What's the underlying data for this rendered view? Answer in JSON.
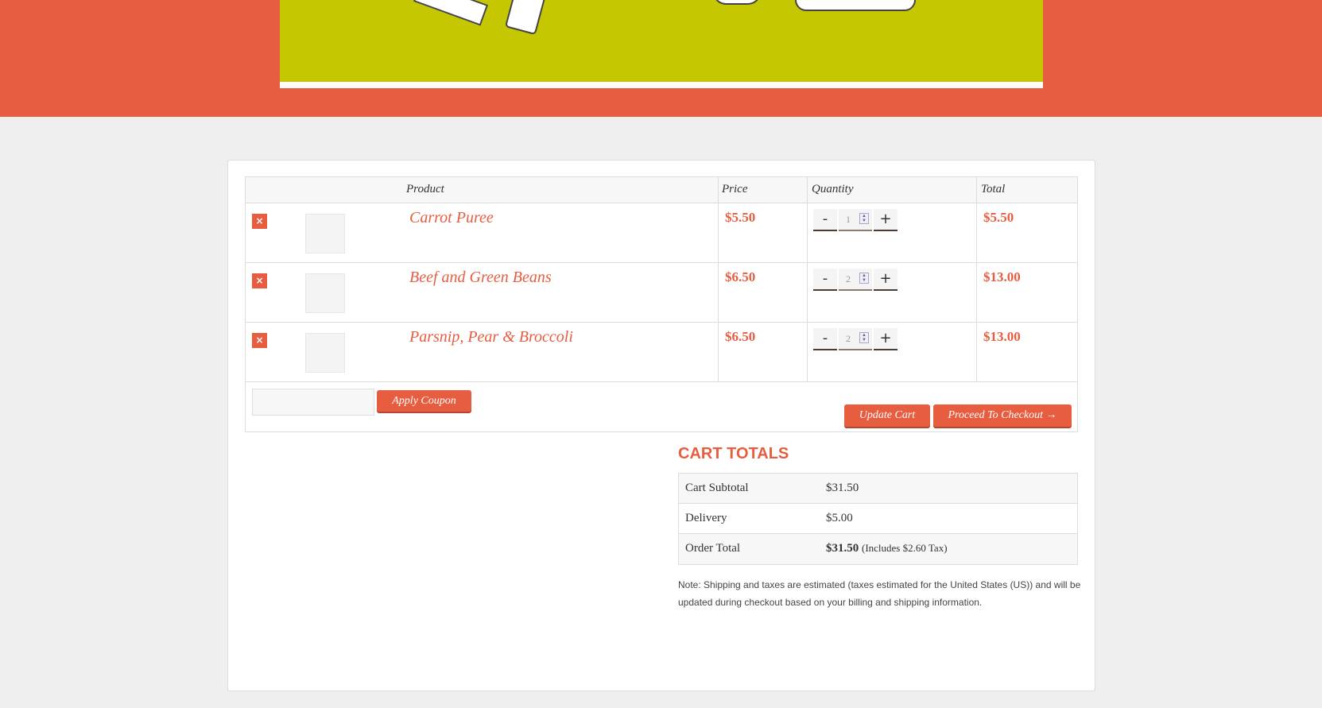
{
  "colors": {
    "accent": "#e65d40",
    "banner": "#c5c700",
    "background": "#efefef"
  },
  "cart": {
    "headers": {
      "product": "Product",
      "price": "Price",
      "quantity": "Quantity",
      "total": "Total"
    },
    "remove_icon": "×",
    "items": [
      {
        "name": "Carrot Puree",
        "price": "$5.50",
        "quantity": "1",
        "total": "$5.50"
      },
      {
        "name": "Beef and Green Beans",
        "price": "$6.50",
        "quantity": "2",
        "total": "$13.00"
      },
      {
        "name": "Parsnip, Pear & Broccoli",
        "price": "$6.50",
        "quantity": "2",
        "total": "$13.00"
      }
    ],
    "minus": "-",
    "plus": "+",
    "coupon_placeholder": "",
    "apply_coupon": "Apply Coupon",
    "update_cart": "Update Cart",
    "checkout": "Proceed To Checkout →"
  },
  "totals": {
    "title": "CART TOTALS",
    "subtotal_label": "Cart Subtotal",
    "subtotal": "$31.50",
    "delivery_label": "Delivery",
    "delivery": "$5.00",
    "order_total_label": "Order Total",
    "order_total": "$31.50",
    "tax_note": "(Includes $2.60 Tax)"
  },
  "note": "Note: Shipping and taxes are estimated (taxes estimated for the United States (US)) and will be updated during checkout based on your billing and shipping information."
}
